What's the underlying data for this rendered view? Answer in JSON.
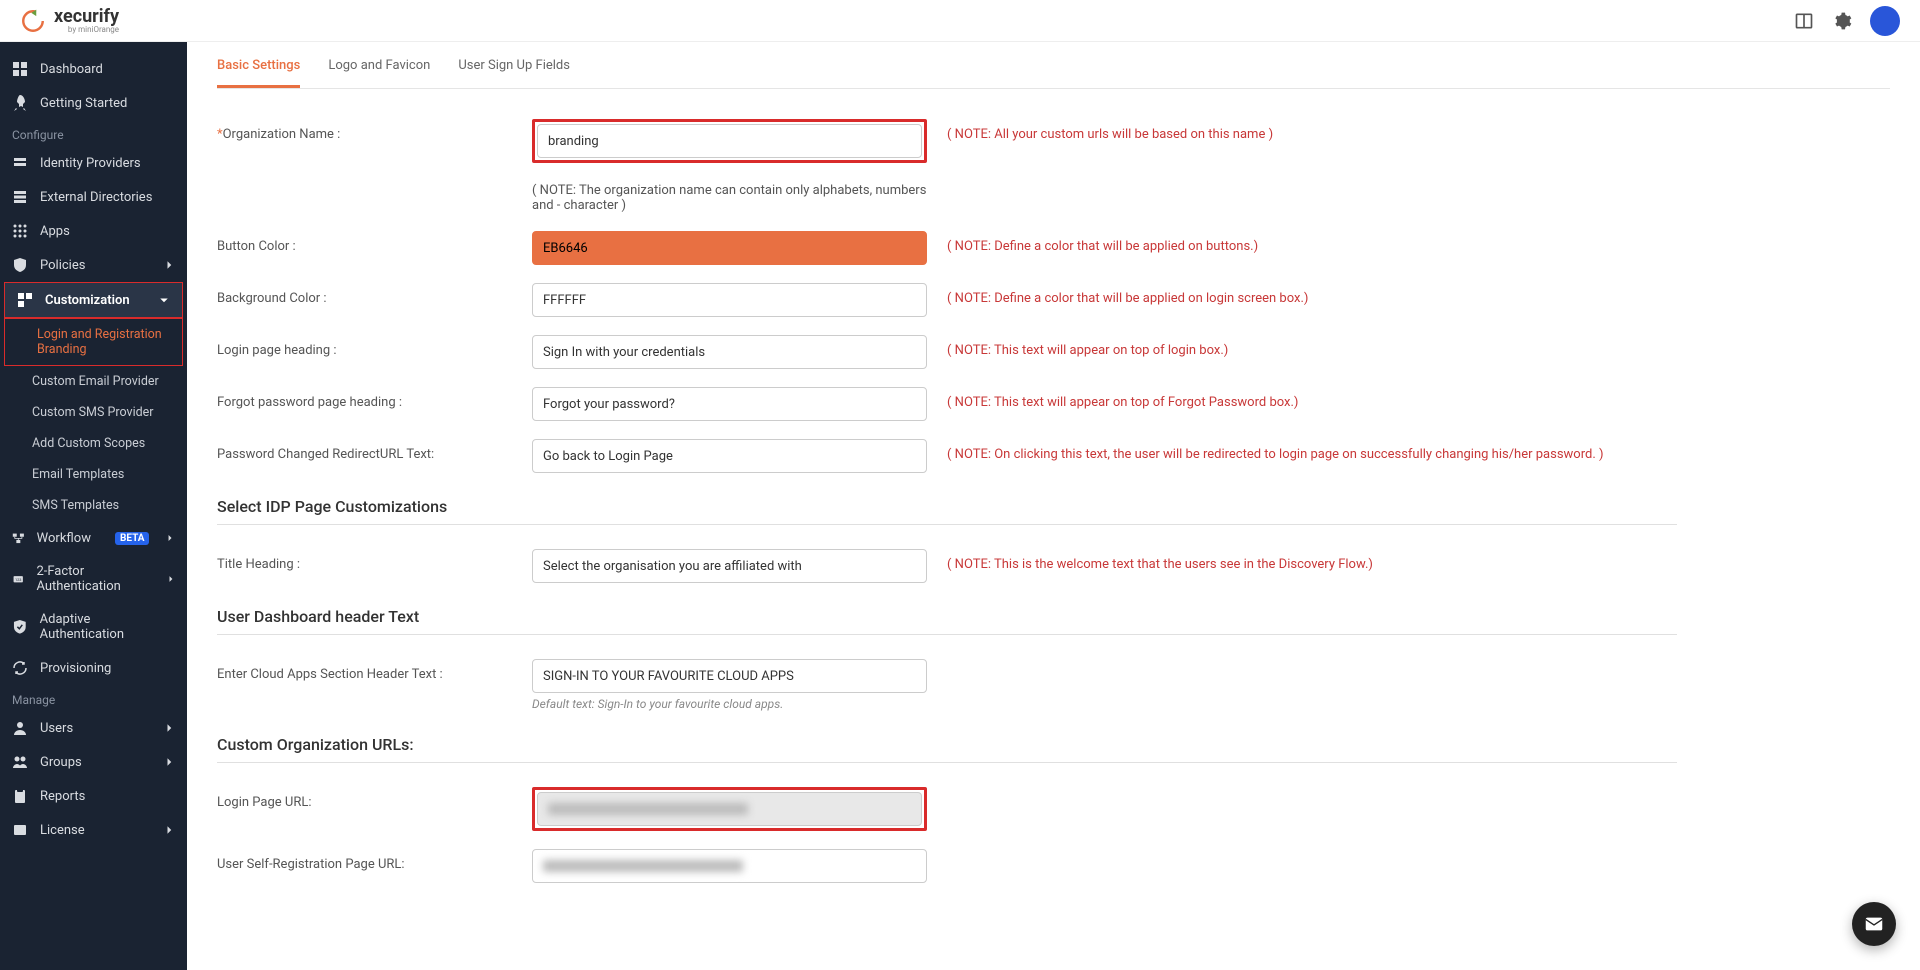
{
  "brand": {
    "name": "xecurify",
    "sub": "by miniOrange"
  },
  "sidebar": {
    "items": {
      "dashboard": "Dashboard",
      "getting_started": "Getting Started",
      "identity_providers": "Identity Providers",
      "external_directories": "External Directories",
      "apps": "Apps",
      "policies": "Policies",
      "customization": "Customization",
      "workflow": "Workflow",
      "two_factor": "2-Factor Authentication",
      "adaptive": "Adaptive Authentication",
      "provisioning": "Provisioning",
      "users": "Users",
      "groups": "Groups",
      "reports": "Reports",
      "license": "License"
    },
    "sections": {
      "configure": "Configure",
      "manage": "Manage"
    },
    "customization_sub": {
      "login_branding": "Login and Registration Branding",
      "email_provider": "Custom Email Provider",
      "sms_provider": "Custom SMS Provider",
      "scopes": "Add Custom Scopes",
      "email_templates": "Email Templates",
      "sms_templates": "SMS Templates"
    },
    "badges": {
      "beta": "BETA"
    }
  },
  "tabs": {
    "basic": "Basic Settings",
    "logo": "Logo and Favicon",
    "signup": "User Sign Up Fields"
  },
  "form": {
    "org_name": {
      "label": "Organization Name :",
      "value": "branding",
      "note": "( NOTE: All your custom urls will be based on this name )",
      "subnote": "( NOTE: The organization name can contain only alphabets, numbers and - character )"
    },
    "button_color": {
      "label": "Button Color :",
      "value": "EB6646",
      "note": "( NOTE: Define a color that will be applied on buttons.)"
    },
    "bg_color": {
      "label": "Background Color :",
      "value": "FFFFFF",
      "note": "( NOTE: Define a color that will be applied on login screen box.)"
    },
    "login_heading": {
      "label": "Login page heading :",
      "value": "Sign In with your credentials",
      "note": "( NOTE: This text will appear on top of login box.)"
    },
    "forgot_heading": {
      "label": "Forgot password page heading :",
      "value": "Forgot your password?",
      "note": "( NOTE: This text will appear on top of Forgot Password box.)"
    },
    "pw_redirect": {
      "label": "Password Changed RedirectURL Text:",
      "value": "Go back to Login Page",
      "note": "( NOTE: On clicking this text, the user will be redirected to login page on successfully changing his/her password. )"
    },
    "title_heading": {
      "label": "Title Heading :",
      "value": "Select the organisation you are affiliated with",
      "note": "( NOTE: This is the welcome text that the users see in the Discovery Flow.)"
    },
    "cloud_apps": {
      "label": "Enter Cloud Apps Section Header Text :",
      "value": "SIGN-IN TO YOUR FAVOURITE CLOUD APPS",
      "subnote": "Default text: Sign-In to your favourite cloud apps."
    },
    "login_url": {
      "label": "Login Page URL:"
    },
    "self_reg_url": {
      "label": "User Self-Registration Page URL:"
    }
  },
  "sections": {
    "idp": "Select IDP Page Customizations",
    "dashboard_header": "User Dashboard header Text",
    "custom_urls": "Custom Organization URLs:"
  }
}
